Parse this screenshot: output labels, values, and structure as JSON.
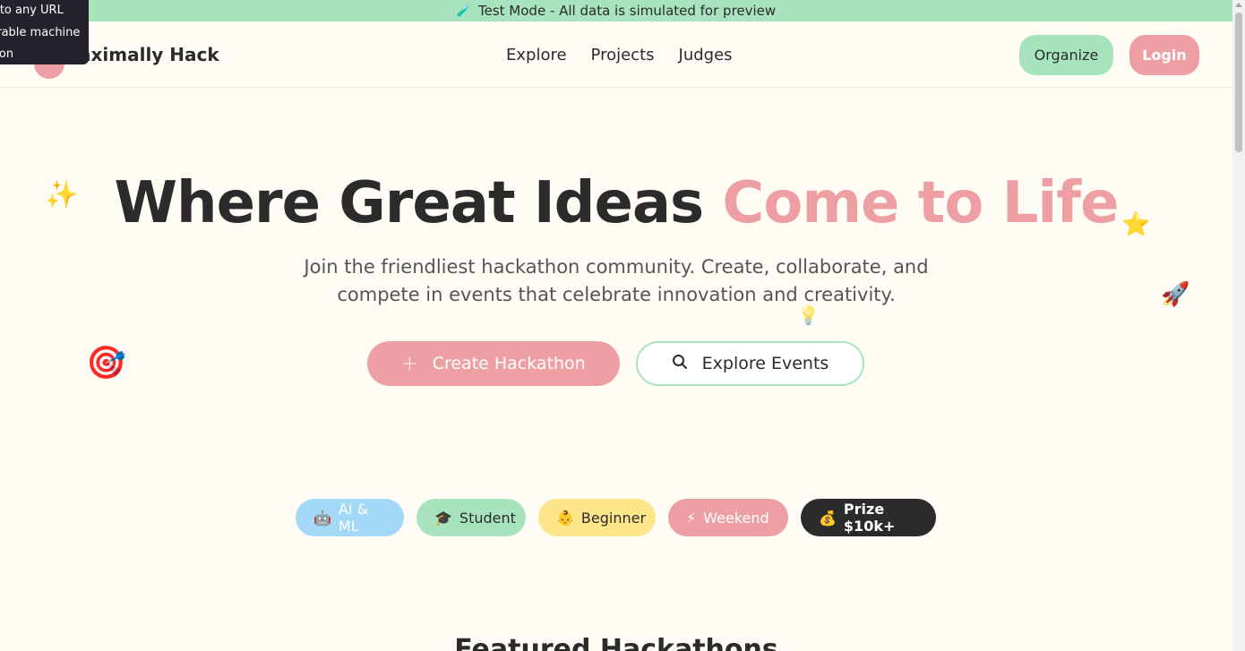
{
  "banner": {
    "icon": "test-tube-icon",
    "text": "Test Mode - All data is simulated for preview"
  },
  "tooltip": {
    "lines": [
      "y to any URL",
      "urable machine",
      "s on"
    ]
  },
  "nav": {
    "brand": "aximally Hack",
    "links": [
      "Explore",
      "Projects",
      "Judges"
    ],
    "organize_label": "Organize",
    "login_label": "Login"
  },
  "hero": {
    "title_main": "Where Great Ideas ",
    "title_accent": "Come to Life",
    "subtitle": "Join the friendliest hackathon community. Create, collaborate, and compete in events that celebrate innovation and creativity.",
    "create_label": "Create Hackathon",
    "create_icon": "plus-icon",
    "explore_label": "Explore Events",
    "explore_icon": "search-icon"
  },
  "tags": [
    {
      "icon": "🤖",
      "label": "AI & ML"
    },
    {
      "icon": "🎓",
      "label": "Student"
    },
    {
      "icon": "👶",
      "label": "Beginner"
    },
    {
      "icon": "⚡",
      "label": "Weekend"
    },
    {
      "icon": "💰",
      "label": "Prize $10k+"
    }
  ],
  "featured_title": "Featured Hackathons",
  "colors": {
    "pink": "#ee9fa3",
    "mint": "#a7e4bd",
    "yellow": "#fde68a",
    "blue": "#a4d8f7",
    "dark": "#2b2b2b"
  }
}
